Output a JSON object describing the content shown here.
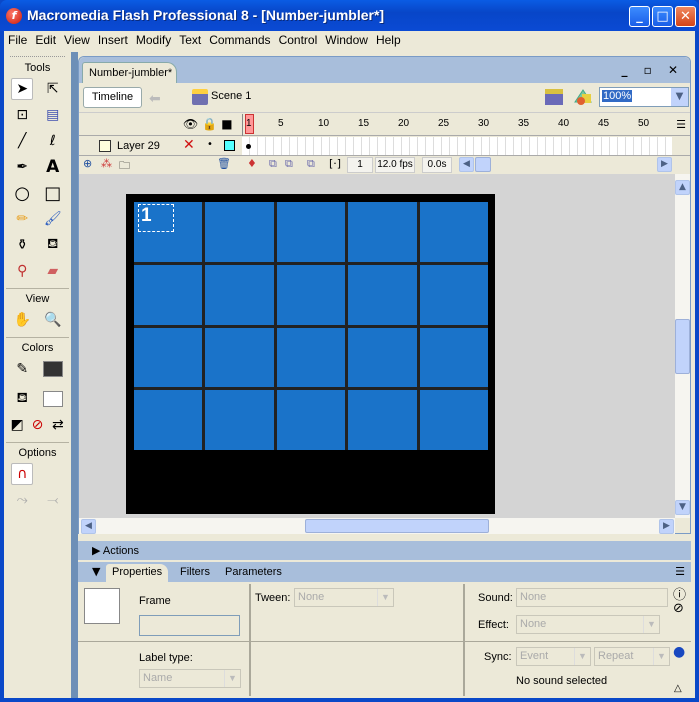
{
  "window": {
    "title": "Macromedia Flash Professional 8 - [Number-jumbler*]",
    "app_icon": "flash-icon",
    "min": "_",
    "max": "□",
    "close": "✕"
  },
  "menu": [
    "File",
    "Edit",
    "View",
    "Insert",
    "Modify",
    "Text",
    "Commands",
    "Control",
    "Window",
    "Help"
  ],
  "tools": {
    "title": "Tools",
    "view_title": "View",
    "colors_title": "Colors",
    "options_title": "Options",
    "colors": {
      "stroke": "#333333",
      "fill": "#ffffff"
    }
  },
  "document": {
    "tab": "Number-jumbler*",
    "controls": "_ ▫ ✕",
    "timeline_button": "Timeline",
    "scene": "Scene 1",
    "zoom": "100%"
  },
  "timeline": {
    "ruler": [
      "1",
      "5",
      "10",
      "15",
      "20",
      "25",
      "30",
      "35",
      "40",
      "45",
      "50"
    ],
    "layer": {
      "name": "Layer 29"
    },
    "current_frame": "1",
    "fps": "12.0 fps",
    "elapsed": "0.0s"
  },
  "stage": {
    "tile_label": "1",
    "grid": {
      "rows": 4,
      "cols": 5
    },
    "tile_color": "#1a73c9",
    "bg": "#000000"
  },
  "panels": {
    "actions": "Actions",
    "tabs": [
      "Properties",
      "Filters",
      "Parameters"
    ],
    "frame_label": "Frame",
    "frame_value": "",
    "label_type": "Label type:",
    "label_type_value": "Name",
    "tween_label": "Tween:",
    "tween_value": "None",
    "sound_label": "Sound:",
    "sound_value": "None",
    "effect_label": "Effect:",
    "effect_value": "None",
    "sync_label": "Sync:",
    "sync_value": "Event",
    "repeat_value": "Repeat",
    "status": "No sound selected"
  }
}
